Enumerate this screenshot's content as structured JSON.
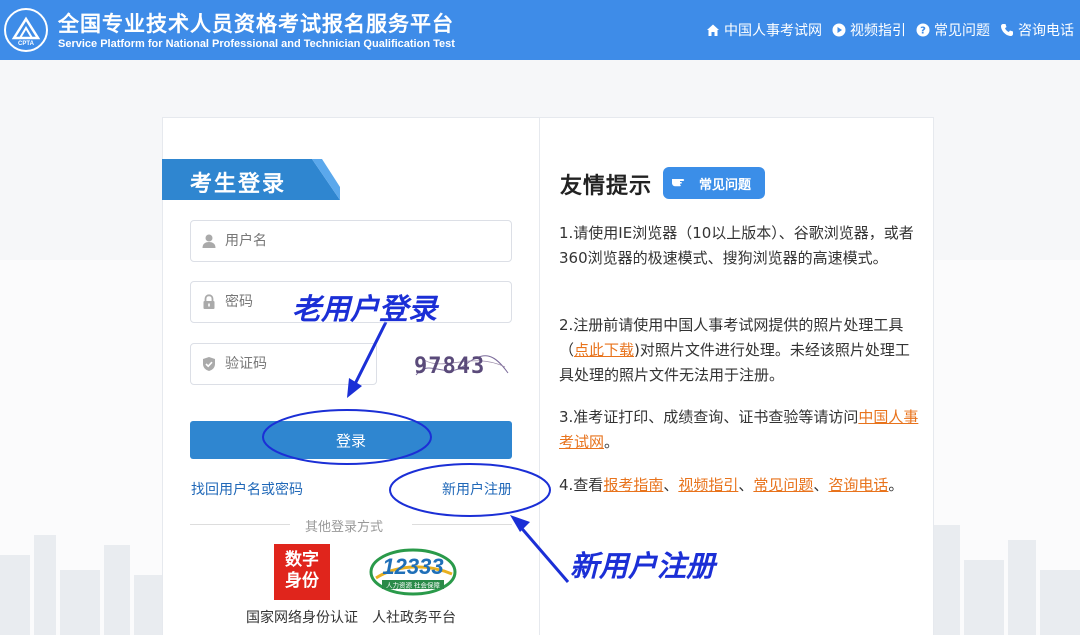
{
  "header": {
    "title_cn": "全国专业技术人员资格考试报名服务平台",
    "title_en": "Service Platform for National Professional and Technician Qualification Test",
    "logo_text": "CPTA",
    "nav": [
      {
        "icon": "home-icon",
        "label": "中国人事考试网"
      },
      {
        "icon": "play-icon",
        "label": "视频指引"
      },
      {
        "icon": "help-icon",
        "label": "常见问题"
      },
      {
        "icon": "phone-icon",
        "label": "咨询电话"
      }
    ]
  },
  "login": {
    "tab_label": "考生登录",
    "username_placeholder": "用户名",
    "password_placeholder": "密码",
    "captcha_placeholder": "验证码",
    "captcha_text": "97843",
    "login_button": "登录",
    "forgot_link": "找回用户名或密码",
    "register_link": "新用户注册",
    "other_methods_label": "其他登录方式",
    "digital_id_text": "数字身份",
    "digital_id_caption": "国家网络身份认证",
    "hrss_text": "12333",
    "hrss_subtext": "人力资源 社会保障",
    "hrss_caption": "人社政务平台"
  },
  "tips": {
    "title": "友情提示",
    "faq_badge": "常见问题",
    "tip1": "1.请使用IE浏览器（10以上版本）、谷歌浏览器，或者360浏览器的极速模式、搜狗浏览器的高速模式。",
    "tip2_pre": "2.注册前请使用中国人事考试网提供的照片处理工具（",
    "tip2_link": "点此下载",
    "tip2_post": ")对照片文件进行处理。未经该照片处理工具处理的照片文件无法用于注册。",
    "tip3_pre": "3.准考证打印、成绩查询、证书查验等请访问",
    "tip3_link": "中国人事考试网",
    "tip3_post": "。",
    "tip4_pre": "4.查看",
    "tip4_link1": "报考指南",
    "tip4_sep1": "、",
    "tip4_link2": "视频指引",
    "tip4_sep2": "、",
    "tip4_link3": "常见问题",
    "tip4_sep3": "、",
    "tip4_link4": "咨询电话",
    "tip4_post": "。"
  },
  "annotations": {
    "old_user": "老用户登录",
    "new_user": "新用户注册"
  },
  "colors": {
    "header_bg": "#3e8ce8",
    "accent_blue": "#2f86d0",
    "link_orange": "#e8731c",
    "annotation_blue": "#1b2fd6"
  }
}
